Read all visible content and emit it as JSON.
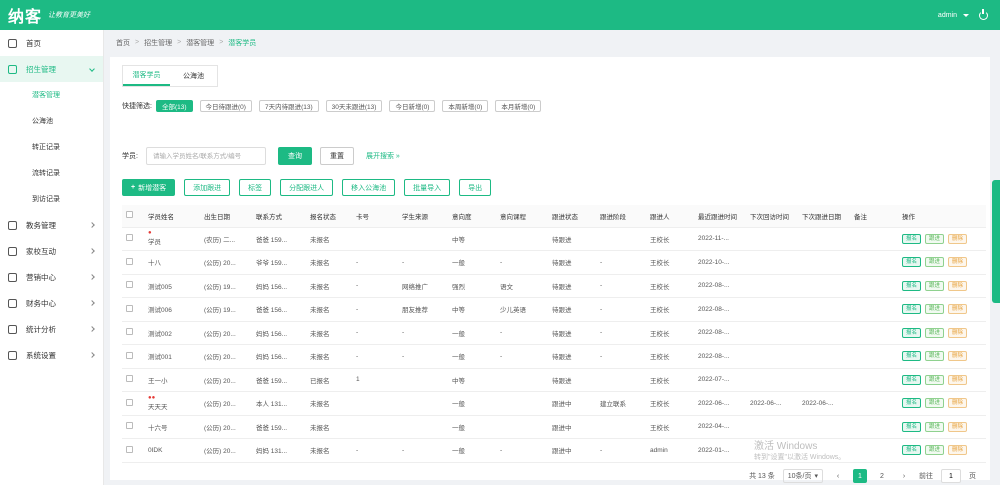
{
  "header": {
    "logo": "纳客",
    "slogan": "让教育更美好",
    "user": "admin"
  },
  "sidebar": {
    "items": [
      {
        "label": "首页",
        "icon": "home-icon"
      },
      {
        "label": "招生管理",
        "icon": "enroll-icon",
        "open": true,
        "children": [
          "潜客管理",
          "公海池",
          "转正记录",
          "流转记录",
          "到访记录"
        ]
      },
      {
        "label": "教务管理",
        "icon": "teaching-icon"
      },
      {
        "label": "家校互动",
        "icon": "home-school-icon"
      },
      {
        "label": "营销中心",
        "icon": "marketing-icon"
      },
      {
        "label": "财务中心",
        "icon": "finance-icon"
      },
      {
        "label": "统计分析",
        "icon": "stats-icon"
      },
      {
        "label": "系统设置",
        "icon": "settings-icon"
      }
    ]
  },
  "breadcrumb": [
    "首页",
    "招生管理",
    "潜客管理",
    "潜客学员"
  ],
  "tabs": [
    "潜客学员",
    "公海池"
  ],
  "quick_filter": {
    "label": "快捷筛选:",
    "chips": [
      "全部(13)",
      "今日待跟进(0)",
      "7天内待跟进(13)",
      "30天未跟进(13)",
      "今日新增(0)",
      "本周新增(0)",
      "本月新增(0)"
    ]
  },
  "search": {
    "label": "学员:",
    "placeholder": "请输入学员姓名/联系方式/编号",
    "query_label": "查询",
    "reset_label": "重置",
    "more_label": "展开搜索 »"
  },
  "actions": [
    {
      "label": "新增潜客",
      "plus": true,
      "solid": true
    },
    {
      "label": "添加跟进"
    },
    {
      "label": "标签"
    },
    {
      "label": "分配跟进人"
    },
    {
      "label": "移入公海池"
    },
    {
      "label": "批量导入"
    },
    {
      "label": "导出"
    }
  ],
  "table": {
    "columns": [
      "学员姓名",
      "出生日期",
      "联系方式",
      "报名状态",
      "卡号",
      "学生来源",
      "意向度",
      "意向课程",
      "跟进状态",
      "跟进阶段",
      "跟进人",
      "最近跟进时间",
      "下次回访时间",
      "下次跟进日期",
      "备注",
      "操作"
    ],
    "rows": [
      {
        "name": "学员",
        "dot": "●",
        "birth": "(农历) 二...",
        "phone": "爸爸 159...",
        "status": "未报名",
        "card": "",
        "source": "",
        "intent": "中等",
        "course": "",
        "fstatus": "待跟进",
        "stage": "",
        "owner": "王校长",
        "last": "2022-11-...",
        "visit": "",
        "next": "",
        "note": ""
      },
      {
        "name": "十八",
        "dot": "",
        "birth": "(公历) 20...",
        "phone": "爷爷 159...",
        "status": "未报名",
        "card": "-",
        "source": "-",
        "intent": "一般",
        "course": "-",
        "fstatus": "待跟进",
        "stage": "-",
        "owner": "王校长",
        "last": "2022-10-...",
        "visit": "",
        "next": "",
        "note": ""
      },
      {
        "name": "测试005",
        "dot": "",
        "birth": "(公历) 19...",
        "phone": "妈妈 156...",
        "status": "未报名",
        "card": "-",
        "source": "网络推广",
        "intent": "强烈",
        "course": "语文",
        "fstatus": "待跟进",
        "stage": "-",
        "owner": "王校长",
        "last": "2022-08-...",
        "visit": "",
        "next": "",
        "note": ""
      },
      {
        "name": "测试006",
        "dot": "",
        "birth": "(公历) 19...",
        "phone": "爸爸 156...",
        "status": "未报名",
        "card": "-",
        "source": "朋友推荐",
        "intent": "中等",
        "course": "少儿英语",
        "fstatus": "待跟进",
        "stage": "-",
        "owner": "王校长",
        "last": "2022-08-...",
        "visit": "",
        "next": "",
        "note": ""
      },
      {
        "name": "测试002",
        "dot": "",
        "birth": "(公历) 20...",
        "phone": "妈妈 156...",
        "status": "未报名",
        "card": "-",
        "source": "-",
        "intent": "一般",
        "course": "-",
        "fstatus": "待跟进",
        "stage": "-",
        "owner": "王校长",
        "last": "2022-08-...",
        "visit": "",
        "next": "",
        "note": ""
      },
      {
        "name": "测试001",
        "dot": "",
        "birth": "(公历) 20...",
        "phone": "妈妈 156...",
        "status": "未报名",
        "card": "-",
        "source": "-",
        "intent": "一般",
        "course": "-",
        "fstatus": "待跟进",
        "stage": "-",
        "owner": "王校长",
        "last": "2022-08-...",
        "visit": "",
        "next": "",
        "note": ""
      },
      {
        "name": "王一小",
        "dot": "",
        "birth": "(公历) 20...",
        "phone": "爸爸 159...",
        "status": "已报名",
        "card": "1",
        "source": "",
        "intent": "中等",
        "course": "",
        "fstatus": "待跟进",
        "stage": "",
        "owner": "王校长",
        "last": "2022-07-...",
        "visit": "",
        "next": "",
        "note": ""
      },
      {
        "name": "天天天",
        "dot": "●●",
        "birth": "(公历) 20...",
        "phone": "本人 131...",
        "status": "未报名",
        "card": "",
        "source": "",
        "intent": "一般",
        "course": "",
        "fstatus": "跟进中",
        "stage": "建立联系",
        "owner": "王校长",
        "last": "2022-06-...",
        "visit": "2022-06-...",
        "next": "2022-06-...",
        "note": ""
      },
      {
        "name": "十六号",
        "dot": "",
        "birth": "(公历) 20...",
        "phone": "爸爸 159...",
        "status": "未报名",
        "card": "",
        "source": "",
        "intent": "一般",
        "course": "",
        "fstatus": "跟进中",
        "stage": "",
        "owner": "王校长",
        "last": "2022-04-...",
        "visit": "",
        "next": "",
        "note": ""
      },
      {
        "name": "0IDK",
        "dot": "",
        "birth": "(公历) 20...",
        "phone": "妈妈 131...",
        "status": "未报名",
        "card": "-",
        "source": "-",
        "intent": "一般",
        "course": "-",
        "fstatus": "跟进中",
        "stage": "-",
        "owner": "admin",
        "last": "2022-01-...",
        "visit": "",
        "next": "",
        "note": ""
      }
    ],
    "ops": [
      "报名",
      "跟进",
      "删除"
    ]
  },
  "pagination": {
    "total": "共 13 条",
    "size": "10条/页",
    "pages": [
      "1",
      "2"
    ],
    "current": "1",
    "goto_label": "前往",
    "goto_value": "1",
    "page_suffix": "页"
  },
  "watermark": {
    "line1": "激活 Windows",
    "line2": "转到\"设置\"以激活 Windows。"
  },
  "colors": {
    "primary": "#1dba84",
    "danger": "#e53935",
    "warning": "#e6a23c"
  }
}
